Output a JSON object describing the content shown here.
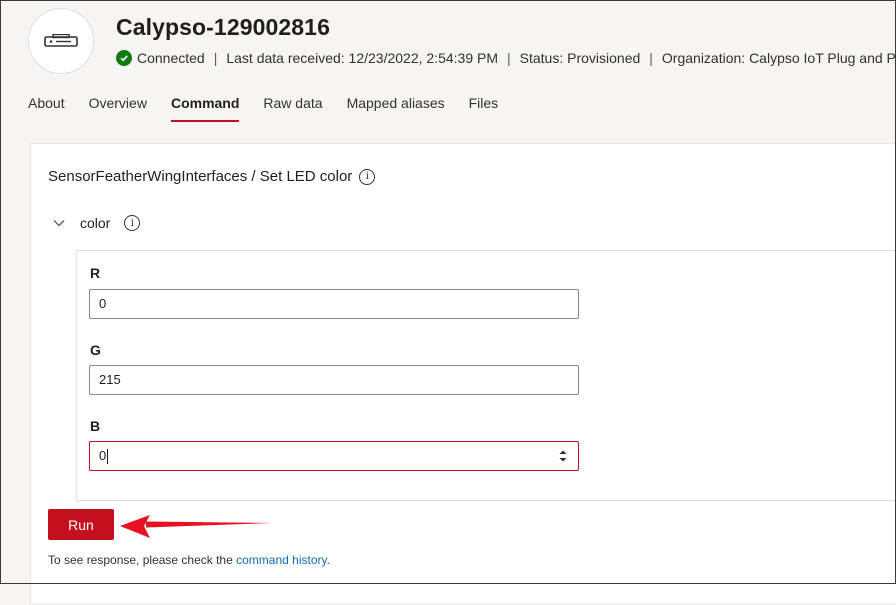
{
  "header": {
    "title": "Calypso-129002816",
    "device_icon": "device-icon",
    "status_icon": "check-circle-icon",
    "connection": "Connected",
    "last_data": "Last data received: 12/23/2022, 2:54:39 PM",
    "status": "Status: Provisioned",
    "organization": "Organization: Calypso IoT Plug and Play",
    "separator": "|"
  },
  "tabs": [
    {
      "label": "About",
      "active": false
    },
    {
      "label": "Overview",
      "active": false
    },
    {
      "label": "Command",
      "active": true
    },
    {
      "label": "Raw data",
      "active": false
    },
    {
      "label": "Mapped aliases",
      "active": false
    },
    {
      "label": "Files",
      "active": false
    }
  ],
  "command": {
    "title": "SensorFeatherWingInterfaces / Set LED color",
    "info_icon": "info-icon",
    "group_label": "color",
    "fields": [
      {
        "label": "R",
        "value": "0"
      },
      {
        "label": "G",
        "value": "215"
      },
      {
        "label": "B",
        "value": "0"
      }
    ],
    "run_label": "Run",
    "footnote_text": "To see response, please check the ",
    "footnote_link": "command history",
    "footnote_end": "."
  },
  "colors": {
    "accent": "#c50f1f",
    "connected": "#107c10",
    "link": "#0f6cbd",
    "annotation_arrow": "#e81123"
  }
}
